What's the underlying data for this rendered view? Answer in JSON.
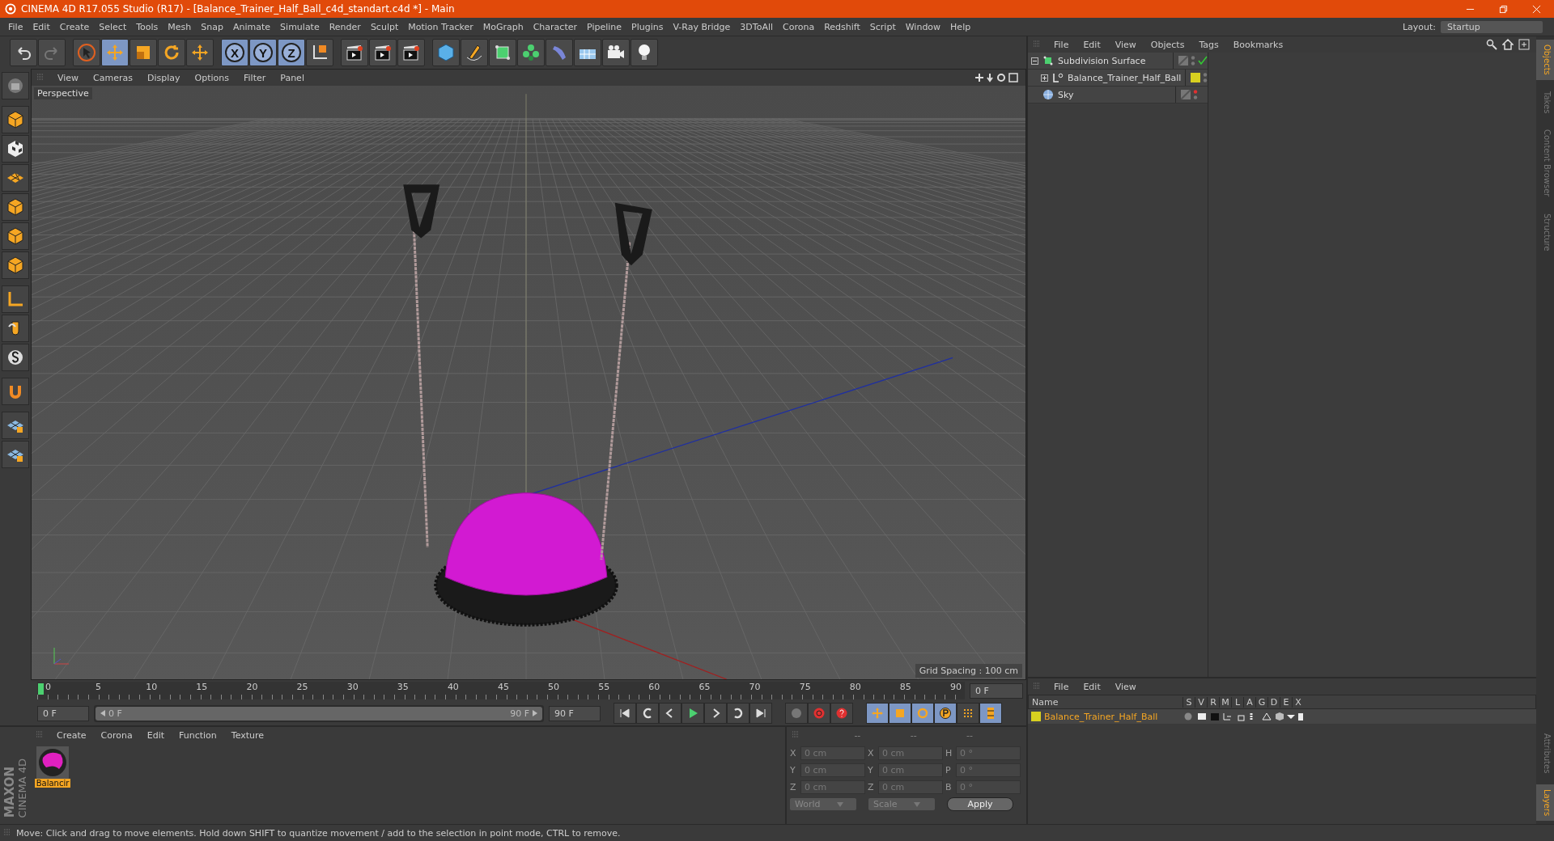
{
  "window": {
    "title": "CINEMA 4D R17.055 Studio (R17) - [Balance_Trainer_Half_Ball_c4d_standart.c4d *] - Main"
  },
  "menus": [
    "File",
    "Edit",
    "Create",
    "Select",
    "Tools",
    "Mesh",
    "Snap",
    "Animate",
    "Simulate",
    "Render",
    "Sculpt",
    "Motion Tracker",
    "MoGraph",
    "Character",
    "Pipeline",
    "Plugins",
    "V-Ray Bridge",
    "3DToAll",
    "Corona",
    "Redshift",
    "Script",
    "Window",
    "Help"
  ],
  "layout": {
    "label": "Layout:",
    "value": "Startup"
  },
  "toolbar": [
    {
      "kind": "undo",
      "selected": false
    },
    {
      "kind": "redo",
      "selected": false
    },
    {
      "kind": "select",
      "selected": false
    },
    {
      "kind": "move",
      "selected": true
    },
    {
      "kind": "scale",
      "selected": false
    },
    {
      "kind": "rotate",
      "selected": false
    },
    {
      "kind": "transform",
      "selected": false
    },
    {
      "kind": "axis",
      "label": "X",
      "selected": true
    },
    {
      "kind": "axis",
      "label": "Y",
      "selected": true
    },
    {
      "kind": "axis",
      "label": "Z",
      "selected": true
    },
    {
      "kind": "coords",
      "selected": false
    },
    {
      "kind": "clapper",
      "selected": false
    },
    {
      "kind": "clapper",
      "selected": false
    },
    {
      "kind": "clapper",
      "selected": false
    },
    {
      "kind": "cube",
      "selected": false
    },
    {
      "kind": "pen",
      "selected": false
    },
    {
      "kind": "subdiv",
      "selected": false
    },
    {
      "kind": "cloner",
      "selected": false
    },
    {
      "kind": "deformer",
      "selected": false
    },
    {
      "kind": "floor",
      "selected": false
    },
    {
      "kind": "camera",
      "selected": false
    },
    {
      "kind": "light",
      "selected": false
    }
  ],
  "left_tools": [
    {
      "kind": "model"
    },
    {
      "kind": "cube"
    },
    {
      "kind": "texture"
    },
    {
      "kind": "floor"
    },
    {
      "kind": "cube"
    },
    {
      "kind": "cube"
    },
    {
      "kind": "cube"
    },
    {
      "kind": "axis"
    },
    {
      "kind": "tweak"
    },
    {
      "kind": "snap"
    },
    {
      "kind": "magnet"
    },
    {
      "kind": "grid"
    },
    {
      "kind": "grid"
    }
  ],
  "viewport": {
    "menus": [
      "View",
      "Cameras",
      "Display",
      "Options",
      "Filter",
      "Panel"
    ],
    "camera": "Perspective",
    "grid_spacing": "Grid Spacing : 100 cm"
  },
  "timeline": {
    "ticks": [
      "0",
      "5",
      "10",
      "15",
      "20",
      "25",
      "30",
      "35",
      "40",
      "45",
      "50",
      "55",
      "60",
      "65",
      "70",
      "75",
      "80",
      "85",
      "90"
    ],
    "current": "0 F",
    "start": "0 F",
    "range": {
      "start": "0 F",
      "end": "90 F",
      "level": 1
    },
    "end": "90 F",
    "transport": [
      {
        "kind": "first"
      },
      {
        "kind": "prev-key"
      },
      {
        "kind": "prev"
      },
      {
        "kind": "play"
      },
      {
        "kind": "next"
      },
      {
        "kind": "next-key"
      },
      {
        "kind": "last"
      }
    ],
    "keys": [
      {
        "kind": "record-off"
      },
      {
        "kind": "record"
      },
      {
        "kind": "autokey"
      }
    ],
    "modes": [
      {
        "kind": "move",
        "selected": true
      },
      {
        "kind": "scale",
        "selected": true
      },
      {
        "kind": "rotate",
        "selected": true
      },
      {
        "kind": "param",
        "selected": true
      },
      {
        "kind": "points",
        "selected": false
      },
      {
        "kind": "film",
        "selected": true
      }
    ]
  },
  "materials": {
    "menus": [
      "Create",
      "Corona",
      "Edit",
      "Function",
      "Texture"
    ],
    "items": [
      {
        "name": "Balancir",
        "selected": true
      }
    ]
  },
  "logo": {
    "brand": "MAXON",
    "product": "CINEMA 4D"
  },
  "coordinates": {
    "headers": [
      "--",
      "--",
      "--"
    ],
    "rows": [
      {
        "axis": "X",
        "position": "0 cm",
        "size_axis": "X",
        "size": "0 cm",
        "rot_axis": "H",
        "rotation": "0 °"
      },
      {
        "axis": "Y",
        "position": "0 cm",
        "size_axis": "Y",
        "size": "0 cm",
        "rot_axis": "P",
        "rotation": "0 °"
      },
      {
        "axis": "Z",
        "position": "0 cm",
        "size_axis": "Z",
        "size": "0 cm",
        "rot_axis": "B",
        "rotation": "0 °"
      }
    ],
    "mode": "World",
    "transform": "Scale",
    "apply": "Apply"
  },
  "objects": {
    "menus": [
      "File",
      "Edit",
      "View",
      "Objects",
      "Tags",
      "Bookmarks"
    ],
    "tree": [
      {
        "name": "Subdivision Surface",
        "kind": "subdiv",
        "expanded": true,
        "visible": true,
        "enabled": true,
        "children": [
          {
            "name": "Balance_Trainer_Half_Ball",
            "kind": "null",
            "expanded": false,
            "visible": true,
            "color": "#d8d020"
          }
        ]
      },
      {
        "name": "Sky",
        "kind": "sky",
        "visible": false
      }
    ]
  },
  "side_tabs": [
    {
      "label": "Objects",
      "selected": true
    },
    {
      "label": "Takes",
      "selected": false
    },
    {
      "label": "Content Browser",
      "selected": false
    },
    {
      "label": "Structure",
      "selected": false
    }
  ],
  "layers": {
    "menus": [
      "File",
      "Edit",
      "View"
    ],
    "columns": [
      "Name",
      "S",
      "V",
      "R",
      "M",
      "L",
      "A",
      "G",
      "D",
      "E",
      "X"
    ],
    "rows": [
      {
        "name": "Balance_Trainer_Half_Ball",
        "color": "#d8d020"
      }
    ]
  },
  "side_tabs_lower": [
    {
      "label": "Attributes",
      "selected": false
    },
    {
      "label": "Layers",
      "selected": true
    }
  ],
  "status": "Move: Click and drag to move elements. Hold down SHIFT to quantize movement / add to the selection in point mode, CTRL to remove."
}
